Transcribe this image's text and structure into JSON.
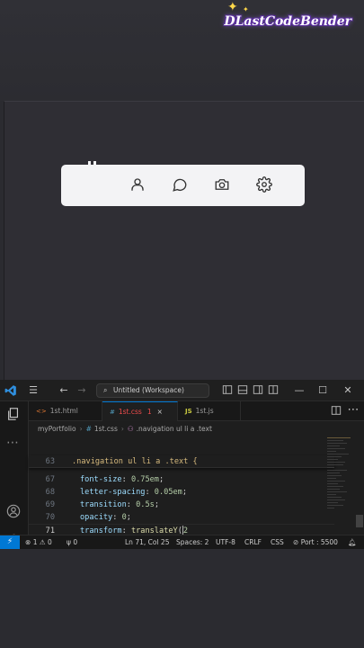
{
  "watermark": {
    "text": "DLastCodeBender"
  },
  "vscode": {
    "search": "Untitled (Workspace)",
    "tabs": [
      {
        "label": "1st.html",
        "icon": "<>"
      },
      {
        "label": "1st.css",
        "icon": "#",
        "badge": "1",
        "close": "×"
      },
      {
        "label": "1st.js",
        "icon": "JS"
      }
    ],
    "breadcrumb": {
      "folder": "myPortfolio",
      "file": "1st.css",
      "selector": ".navigation ul li a .text"
    },
    "sticky": {
      "num": "63",
      "code": ".navigation ul li a .text {"
    },
    "lines": [
      {
        "num": "67",
        "prop": "font-size",
        "value": "0.75em"
      },
      {
        "num": "68",
        "prop": "letter-spacing",
        "value": "0.05em"
      },
      {
        "num": "69",
        "prop": "transition",
        "value": "0.5s"
      },
      {
        "num": "70",
        "prop": "opacity",
        "value": "0"
      }
    ],
    "current_line": {
      "num": "71",
      "prop": "transform",
      "fn": "translateY",
      "arg": "2"
    },
    "status": {
      "errors": "1",
      "warnings": "0",
      "ports": "0",
      "position": "Ln 71, Col 25",
      "spaces": "Spaces: 2",
      "encoding": "UTF-8",
      "eol": "CRLF",
      "language": "CSS",
      "port": "Port : 5500"
    }
  }
}
